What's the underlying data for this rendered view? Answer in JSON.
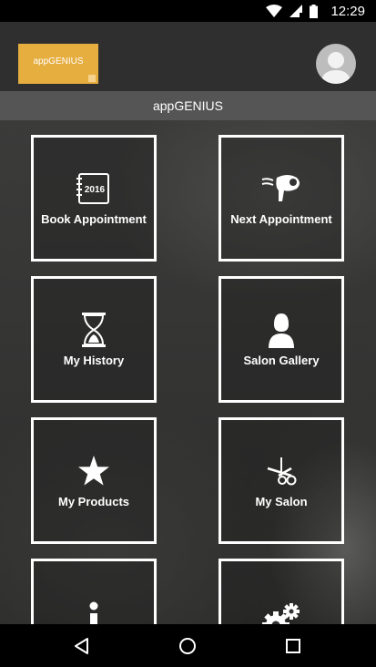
{
  "status_bar": {
    "time": "12:29",
    "icons": [
      "wifi-icon",
      "signal-icon",
      "battery-icon"
    ]
  },
  "header": {
    "logo_text": "appGENIUS",
    "brand_color": "#e6ad3f",
    "avatar": "default-avatar-icon"
  },
  "title_bar": {
    "title": "appGENIUS"
  },
  "tiles": [
    {
      "label": "Book Appointment",
      "icon": "calendar-icon",
      "icon_text": "2016"
    },
    {
      "label": "Next Appointment",
      "icon": "hairdryer-icon"
    },
    {
      "label": "My History",
      "icon": "hourglass-icon"
    },
    {
      "label": "Salon Gallery",
      "icon": "person-icon"
    },
    {
      "label": "My Products",
      "icon": "star-icon"
    },
    {
      "label": "My Salon",
      "icon": "scissors-icon"
    },
    {
      "label": "",
      "icon": "info-icon"
    },
    {
      "label": "",
      "icon": "gears-icon"
    }
  ],
  "nav_bar": {
    "buttons": [
      "back-icon",
      "home-icon",
      "recents-icon"
    ]
  }
}
